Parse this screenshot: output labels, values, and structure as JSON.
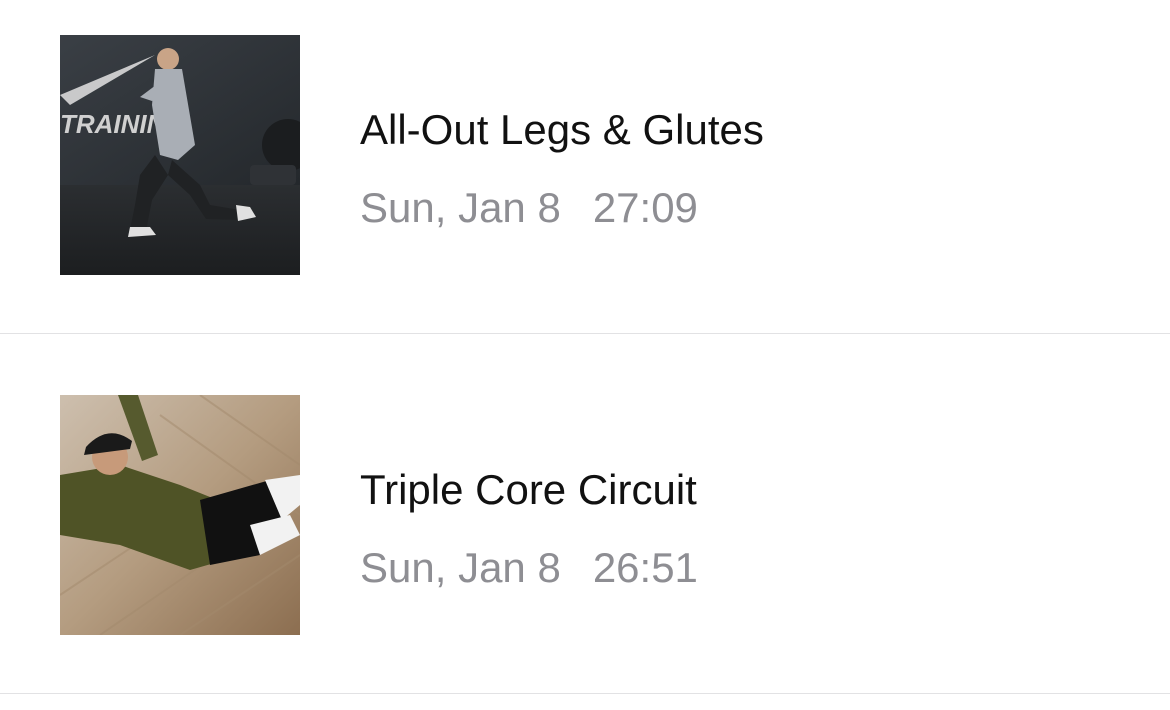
{
  "workouts": [
    {
      "title": "All-Out Legs & Glutes",
      "date": "Sun, Jan 8",
      "duration": "27:09",
      "thumbnail_icon": "athlete-lunge-photo",
      "thumbnail_wall_text": "TRAINING"
    },
    {
      "title": "Triple Core Circuit",
      "date": "Sun, Jan 8",
      "duration": "26:51",
      "thumbnail_icon": "athlete-situp-photo"
    }
  ],
  "colors": {
    "title": "#111111",
    "meta": "#8e8e93",
    "divider": "#e2e2e4",
    "background": "#ffffff"
  }
}
